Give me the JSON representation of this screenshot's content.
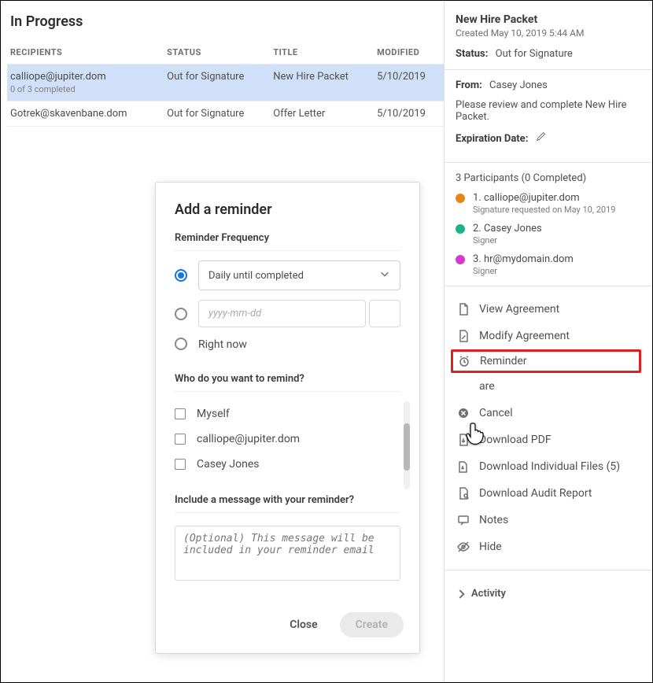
{
  "page_title": "In Progress",
  "table": {
    "headers": {
      "recipients": "RECIPIENTS",
      "status": "STATUS",
      "title": "TITLE",
      "modified": "MODIFIED"
    },
    "rows": [
      {
        "email": "calliope@jupiter.dom",
        "sub": "0 of 3 completed",
        "status": "Out for Signature",
        "title": "New Hire Packet",
        "modified": "5/10/2019"
      },
      {
        "email": "Gotrek@skavenbane.dom",
        "sub": "",
        "status": "Out for Signature",
        "title": "Offer Letter",
        "modified": "5/10/2019"
      }
    ]
  },
  "reminder": {
    "title": "Add a reminder",
    "freq_label": "Reminder Frequency",
    "daily_option": "Daily until completed",
    "date_placeholder": "yyyy-mm-dd",
    "right_now": "Right now",
    "who_label": "Who do you want to remind?",
    "who_options": [
      "Myself",
      "calliope@jupiter.dom",
      "Casey Jones"
    ],
    "msg_label": "Include a message with your reminder?",
    "msg_placeholder": "(Optional) This message will be included in your reminder email",
    "close": "Close",
    "create": "Create"
  },
  "details": {
    "title": "New Hire Packet",
    "created": "Created May 10, 2019 5:44 AM",
    "status_label": "Status:",
    "status_value": "Out for Signature",
    "from_label": "From:",
    "from_value": "Casey Jones",
    "message": "Please review and complete New Hire Packet.",
    "exp_label": "Expiration Date:",
    "participants_hdr": "3 Participants (0 Completed)",
    "participants": [
      {
        "color": "#e68619",
        "name": "1. calliope@jupiter.dom",
        "sub": "Signature requested on May 10, 2019"
      },
      {
        "color": "#1db28c",
        "name": "2. Casey Jones",
        "sub": "Signer"
      },
      {
        "color": "#d83bca",
        "name": "3. hr@mydomain.dom",
        "sub": "Signer"
      }
    ],
    "actions": {
      "view": "View Agreement",
      "modify": "Modify Agreement",
      "reminder": "Reminder",
      "share": "are",
      "cancel": "Cancel",
      "download_pdf": "Download PDF",
      "download_files": "Download Individual Files (5)",
      "audit": "Download Audit Report",
      "notes": "Notes",
      "hide": "Hide"
    },
    "activity": "Activity"
  }
}
